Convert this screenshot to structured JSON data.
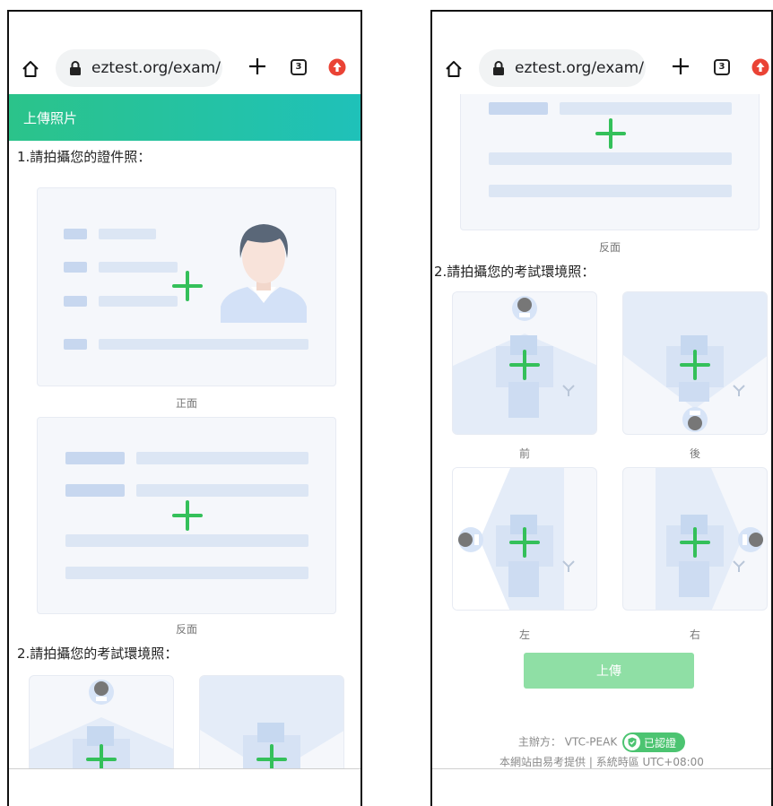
{
  "browser": {
    "url": "eztest.org/exam/",
    "tab_count": "3"
  },
  "header": {
    "title": "上傳照片"
  },
  "id_section": {
    "title": "1.請拍攝您的證件照：",
    "front_label": "正面",
    "back_label": "反面"
  },
  "env_section": {
    "title": "2.請拍攝您的考試環境照：",
    "front_label": "前",
    "back_label": "後",
    "left_label": "左",
    "right_label": "右"
  },
  "upload_button": {
    "label": "上傳"
  },
  "footer": {
    "organizer_prefix": "主辦方：",
    "organizer_name": "VTC-PEAK",
    "verified_badge": "已認證",
    "provider_line": "本網站由易考提供 | 系統時區 UTC+08:00"
  },
  "colors": {
    "header_start": "#2bc38a",
    "header_end": "#1fc1b9",
    "plus_green": "#34c05a",
    "upload_button": "#8fdfa5",
    "badge": "#4cc471"
  },
  "icons": [
    "home-icon",
    "lock-icon",
    "new-tab-icon",
    "tab-switcher-icon",
    "update-icon",
    "shield-check-icon"
  ]
}
